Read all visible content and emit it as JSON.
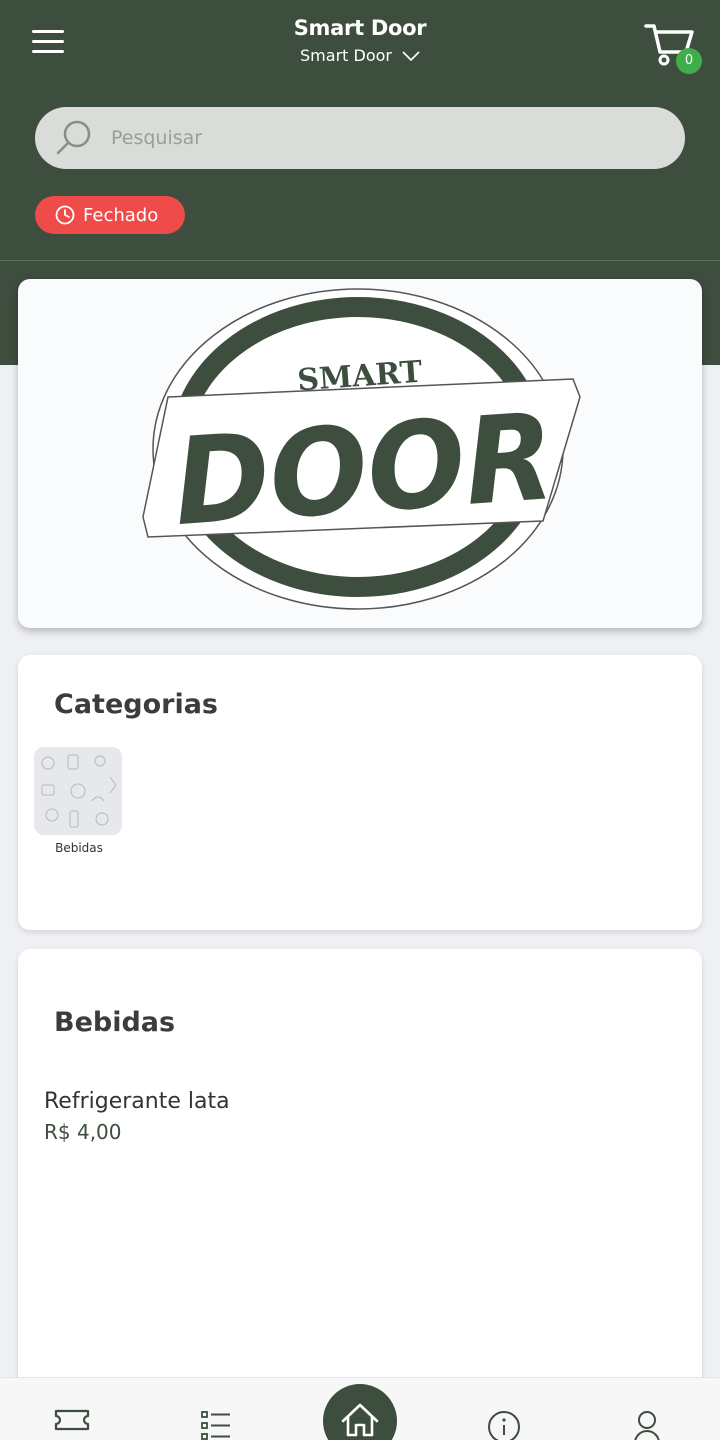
{
  "header": {
    "title": "Smart Door",
    "store_name": "Smart Door",
    "cart_count": "0",
    "bg_color": "#3d4d3e"
  },
  "search": {
    "placeholder": "Pesquisar",
    "value": ""
  },
  "status": {
    "label": "Fechado",
    "color": "#f04b4b"
  },
  "logo": {
    "small_text": "SMART",
    "big_text": "DOOR"
  },
  "categories": {
    "title": "Categorias",
    "items": [
      {
        "label": "Bebidas"
      }
    ]
  },
  "products_section": {
    "title": "Bebidas",
    "items": [
      {
        "name": "Refrigerante lata",
        "price": "R$ 4,00"
      }
    ]
  },
  "bottom_nav": {
    "items": [
      "ticket-icon",
      "list-icon",
      "home-icon",
      "info-icon",
      "user-icon"
    ],
    "active": "home-icon"
  }
}
